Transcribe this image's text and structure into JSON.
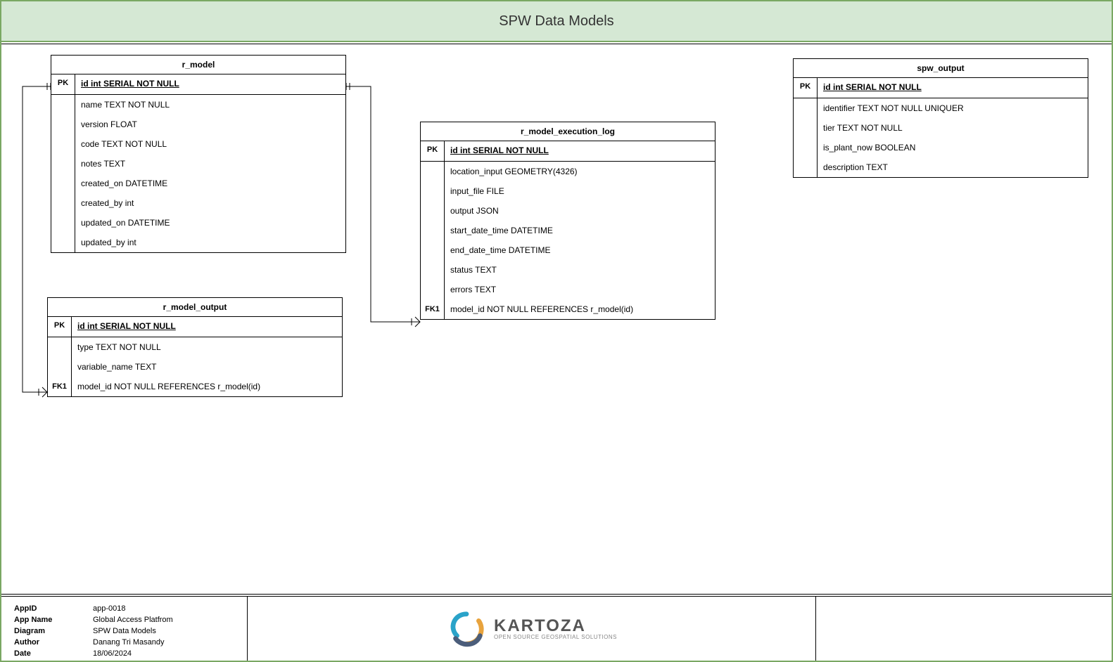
{
  "header": {
    "title": "SPW Data Models"
  },
  "entities": {
    "r_model": {
      "name": "r_model",
      "pk_key": "PK",
      "pk_field": "id int SERIAL NOT NULL",
      "fields": [
        "name TEXT NOT NULL",
        "version FLOAT",
        "code TEXT NOT NULL",
        "notes TEXT",
        "created_on DATETIME",
        "created_by int",
        "updated_on DATETIME",
        "updated_by int"
      ]
    },
    "r_model_output": {
      "name": "r_model_output",
      "pk_key": "PK",
      "pk_field": "id int SERIAL NOT NULL",
      "fields": [
        "type TEXT NOT NULL",
        "variable_name TEXT"
      ],
      "fk_key": "FK1",
      "fk_field": "model_id NOT NULL REFERENCES r_model(id)"
    },
    "r_model_execution_log": {
      "name": "r_model_execution_log",
      "pk_key": "PK",
      "pk_field": "id int SERIAL NOT NULL",
      "fields": [
        "location_input GEOMETRY(4326)",
        "input_file FILE",
        "output JSON",
        "start_date_time DATETIME",
        "end_date_time DATETIME",
        "status TEXT",
        "errors TEXT"
      ],
      "fk_key": "FK1",
      "fk_field": "model_id NOT NULL REFERENCES r_model(id)"
    },
    "spw_output": {
      "name": "spw_output",
      "pk_key": "PK",
      "pk_field": "id int SERIAL NOT NULL",
      "fields": [
        "identifier TEXT NOT NULL UNIQUER",
        "tier TEXT NOT NULL",
        "is_plant_now BOOLEAN",
        "description TEXT"
      ]
    }
  },
  "footer": {
    "rows": [
      {
        "label": "AppID",
        "value": "app-0018"
      },
      {
        "label": "App Name",
        "value": "Global Access Platfrom"
      },
      {
        "label": "Diagram",
        "value": "SPW Data Models"
      },
      {
        "label": "Author",
        "value": "Danang Tri Masandy"
      },
      {
        "label": "Date",
        "value": "18/06/2024"
      }
    ],
    "logo": {
      "brand": "KARTOZA",
      "tagline": "OPEN SOURCE GEOSPATIAL SOLUTIONS"
    }
  }
}
